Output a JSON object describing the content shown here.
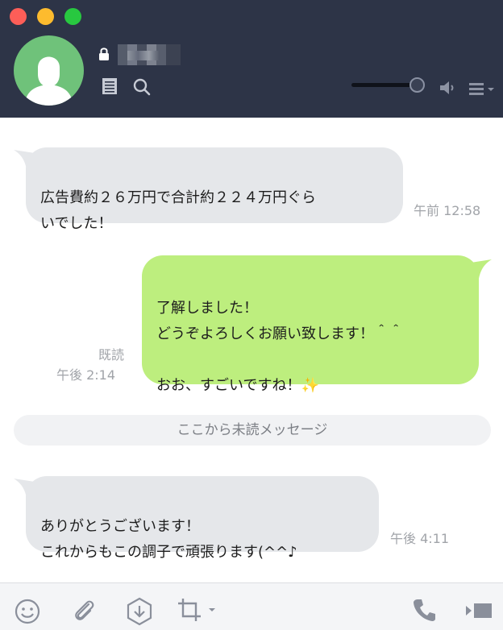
{
  "header": {
    "window_controls": {
      "close": "close-dot",
      "minimize": "minimize-dot",
      "zoom": "zoom-dot"
    },
    "contact": {
      "avatar": "default-person-avatar",
      "lock": "lock-icon",
      "name_redacted": true
    },
    "icons": [
      "note-icon",
      "search-icon",
      "speaker-icon",
      "menu-icon"
    ],
    "volume_level": 0.88
  },
  "messages": [
    {
      "side": "incoming",
      "text": "広告費約２６万円で合計約２２４万円ぐら\nいでした！",
      "time": "午前 12:58"
    },
    {
      "side": "outgoing",
      "text": "了解しました！\nどうぞよろしくお願い致します！＾＾\n\nおお、すごいですね！✨",
      "read": "既読",
      "time": "午後 2:14"
    },
    {
      "side": "incoming",
      "text": "ありがとうございます！\nこれからもこの調子で頑張ります(^^♪",
      "time": "午後 4:11"
    }
  ],
  "divider": "ここから未読メッセージ",
  "footer": {
    "icons": [
      "emoji-icon",
      "attach-icon",
      "download-icon",
      "crop-icon",
      "phone-icon",
      "video-icon"
    ]
  },
  "colors": {
    "header_bg": "#2d3447",
    "incoming_bubble": "#e5e7ea",
    "outgoing_bubble": "#bdee7e"
  }
}
